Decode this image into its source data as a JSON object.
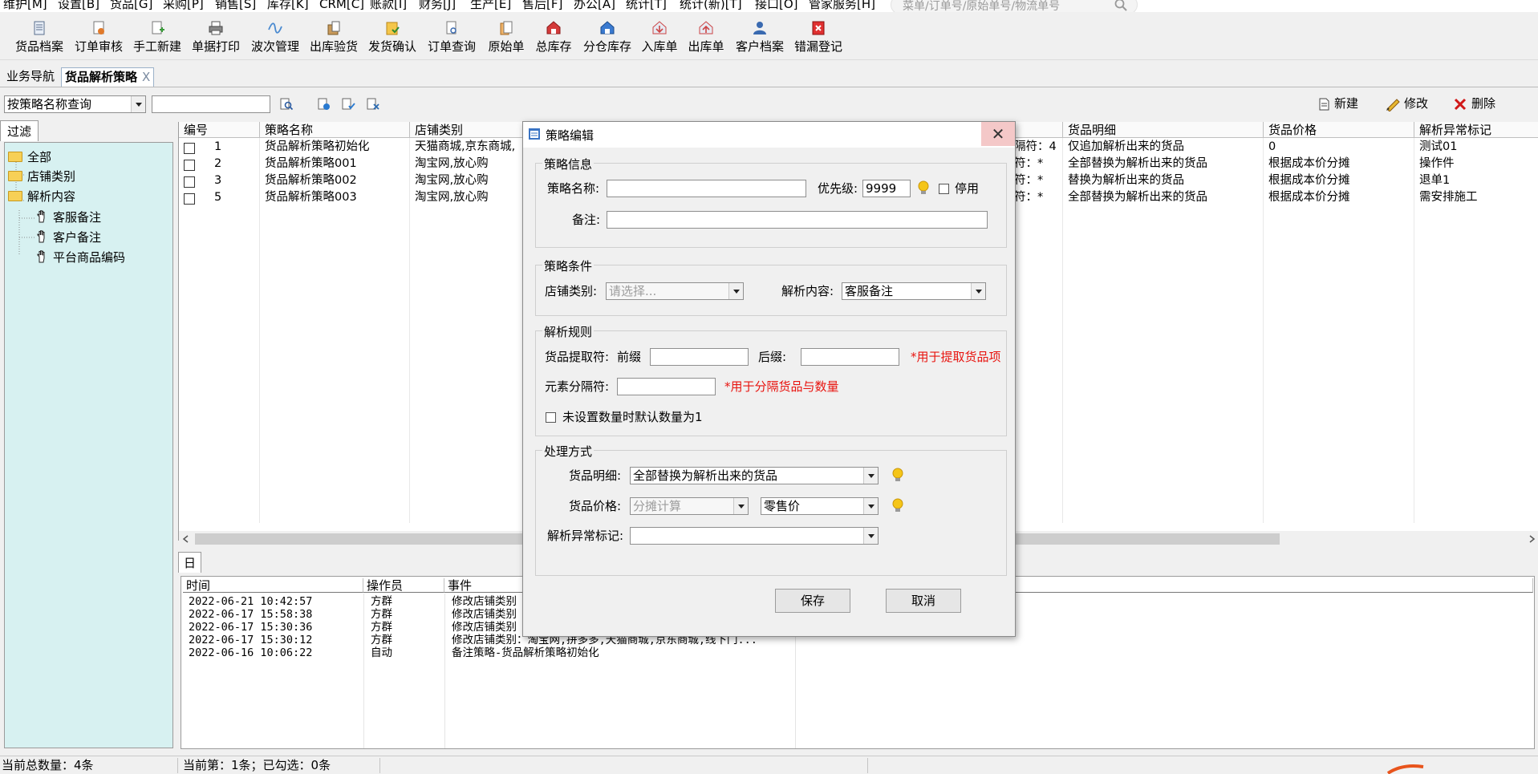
{
  "menu": [
    "维护[M]",
    "设置[B]",
    "货品[G]",
    "采购[P]",
    "销售[S]",
    "库存[K]",
    "CRM[C]",
    "账款[I]",
    "财务[J]",
    "生产[E]",
    "售后[F]",
    "办公[A]",
    "统计[T]",
    "统计(新)[T]",
    "接口[O]",
    "管家服务[H]"
  ],
  "menu_search_placeholder": "菜单/订单号/原始单号/物流单号",
  "toolbar": [
    "货品档案",
    "订单审核",
    "手工新建",
    "单据打印",
    "波次管理",
    "出库验货",
    "发货确认",
    "订单查询",
    "原始单",
    "总库存",
    "分仓库存",
    "入库单",
    "出库单",
    "客户档案",
    "错漏登记"
  ],
  "tabs": {
    "nav": "业务导航",
    "active": "货品解析策略",
    "close": "X"
  },
  "query_combo": "按策略名称查询",
  "actions": {
    "new": "新建",
    "edit": "修改",
    "delete": "删除"
  },
  "left": {
    "tab": "过滤",
    "tree": [
      "全部",
      "店铺类别",
      "解析内容",
      "客服备注",
      "客户备注",
      "平台商品编码"
    ]
  },
  "grid": {
    "headers": [
      "编号",
      "策略名称",
      "店铺类别",
      "货品明细",
      "货品价格",
      "解析异常标记"
    ],
    "rows": [
      {
        "id": "1",
        "name": "货品解析策略初始化",
        "shop": "天猫商城,京东商城,",
        "sep": "隔符：4",
        "detail": "仅追加解析出来的货品",
        "price": "0",
        "flag": "测试01"
      },
      {
        "id": "2",
        "name": "货品解析策略001",
        "shop": "淘宝网,放心购",
        "sep": "符：*",
        "detail": "全部替换为解析出来的货品",
        "price": "根据成本价分摊",
        "flag": "操作件"
      },
      {
        "id": "3",
        "name": "货品解析策略002",
        "shop": "淘宝网,放心购",
        "sep": "符：*",
        "detail": "替换为解析出来的货品",
        "price": "根据成本价分摊",
        "flag": "退单1"
      },
      {
        "id": "5",
        "name": "货品解析策略003",
        "shop": "淘宝网,放心购",
        "sep": "符：*",
        "detail": "全部替换为解析出来的货品",
        "price": "根据成本价分摊",
        "flag": "需安排施工"
      }
    ]
  },
  "log": {
    "tab": "日志",
    "headers": [
      "时间",
      "操作员",
      "事件"
    ],
    "rows": [
      {
        "time": "2022-06-21 10:42:57",
        "op": "方群",
        "event": "修改店铺类别"
      },
      {
        "time": "2022-06-17 15:58:38",
        "op": "方群",
        "event": "修改店铺类别"
      },
      {
        "time": "2022-06-17 15:30:36",
        "op": "方群",
        "event": "修改店铺类别"
      },
      {
        "time": "2022-06-17 15:30:12",
        "op": "方群",
        "event": "修改店铺类别：淘宝网,拼多多,天猫商城,京东商城,线下门..."
      },
      {
        "time": "2022-06-16 10:06:22",
        "op": "自动",
        "event": "备注策略-货品解析策略初始化"
      }
    ]
  },
  "status": {
    "total": "当前总数量：4条",
    "current": "当前第：1条；已勾选：0条"
  },
  "dialog": {
    "title": "策略编辑",
    "info": {
      "caption": "策略信息",
      "name_label": "策略名称:",
      "name_value": "",
      "priority_label": "优先级:",
      "priority_value": "9999",
      "disable_label": "停用",
      "remark_label": "备注:",
      "remark_value": ""
    },
    "cond": {
      "caption": "策略条件",
      "shop_label": "店铺类别:",
      "shop_placeholder": "请选择...",
      "content_label": "解析内容:",
      "content_value": "客服备注"
    },
    "rule": {
      "caption": "解析规则",
      "extract_label": "货品提取符:",
      "prefix_label": "前缀",
      "suffix_label": "后缀:",
      "extract_hint": "*用于提取货品项",
      "sep_label": "元素分隔符:",
      "sep_hint": "*用于分隔货品与数量",
      "default_qty_label": "未设置数量时默认数量为1"
    },
    "handle": {
      "caption": "处理方式",
      "detail_label": "货品明细:",
      "detail_value": "全部替换为解析出来的货品",
      "price_label": "货品价格:",
      "price_mode": "分摊计算",
      "price_value": "零售价",
      "flag_label": "解析异常标记:",
      "flag_value": ""
    },
    "save": "保存",
    "cancel": "取消"
  }
}
